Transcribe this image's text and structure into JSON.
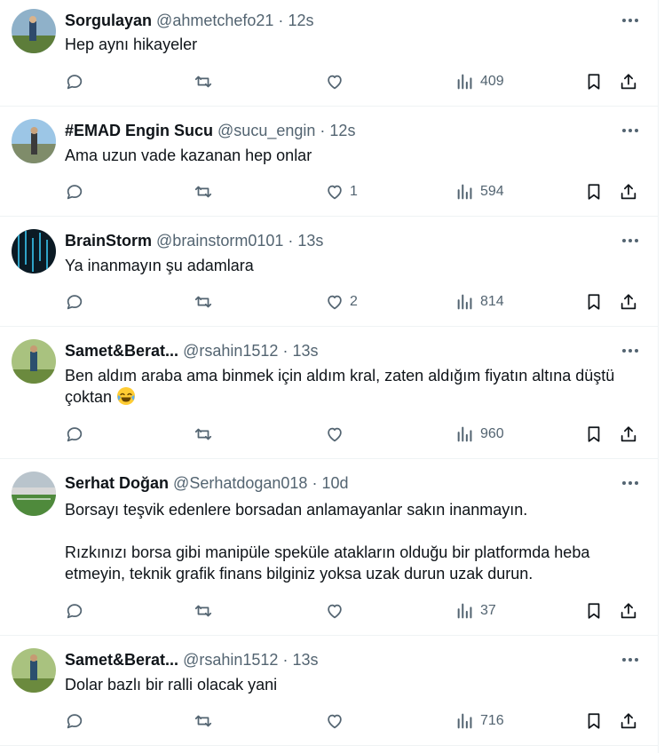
{
  "tweets": [
    {
      "name": "Sorgulayan",
      "handle": "@ahmetchefo21",
      "dot": "·",
      "time": "12s",
      "text": [
        "Hep aynı hikayeler"
      ],
      "likes": "",
      "views": "409"
    },
    {
      "name": "#EMAD Engin Sucu",
      "handle": "@sucu_engin",
      "dot": "·",
      "time": "12s",
      "text": [
        "Ama uzun vade kazanan hep onlar"
      ],
      "likes": "1",
      "views": "594"
    },
    {
      "name": "BrainStorm",
      "handle": "@brainstorm0101",
      "dot": "·",
      "time": "13s",
      "text": [
        "Ya inanmayın şu adamlara"
      ],
      "likes": "2",
      "views": "814"
    },
    {
      "name": "Samet&Berat...",
      "handle": "@rsahin1512",
      "dot": "·",
      "time": "13s",
      "text": [
        "Ben aldım araba ama binmek için aldım kral, zaten aldığım fiyatın altına düştü çoktan"
      ],
      "emoji": "face-with-tears-of-joy",
      "likes": "",
      "views": "960"
    },
    {
      "name": "Serhat Doğan",
      "handle": "@Serhatdogan018",
      "dot": "·",
      "time": "10d",
      "text": [
        "Borsayı teşvik edenlere borsadan anlamayanlar sakın inanmayın.",
        "Rızkınızı borsa gibi manipüle speküle atakların olduğu bir platformda heba etmeyin, teknik grafik finans bilginiz yoksa uzak durun uzak durun."
      ],
      "likes": "",
      "views": "37"
    },
    {
      "name": "Samet&Berat...",
      "handle": "@rsahin1512",
      "dot": "·",
      "time": "13s",
      "text": [
        "Dolar bazlı bir ralli olacak yani"
      ],
      "likes": "",
      "views": "716"
    }
  ],
  "colors": {
    "text": "#0f1419",
    "secondary": "#536471",
    "divider": "#eff3f4"
  },
  "icons": [
    "reply-icon",
    "retweet-icon",
    "like-icon",
    "views-icon",
    "bookmark-icon",
    "share-icon",
    "more-icon"
  ]
}
